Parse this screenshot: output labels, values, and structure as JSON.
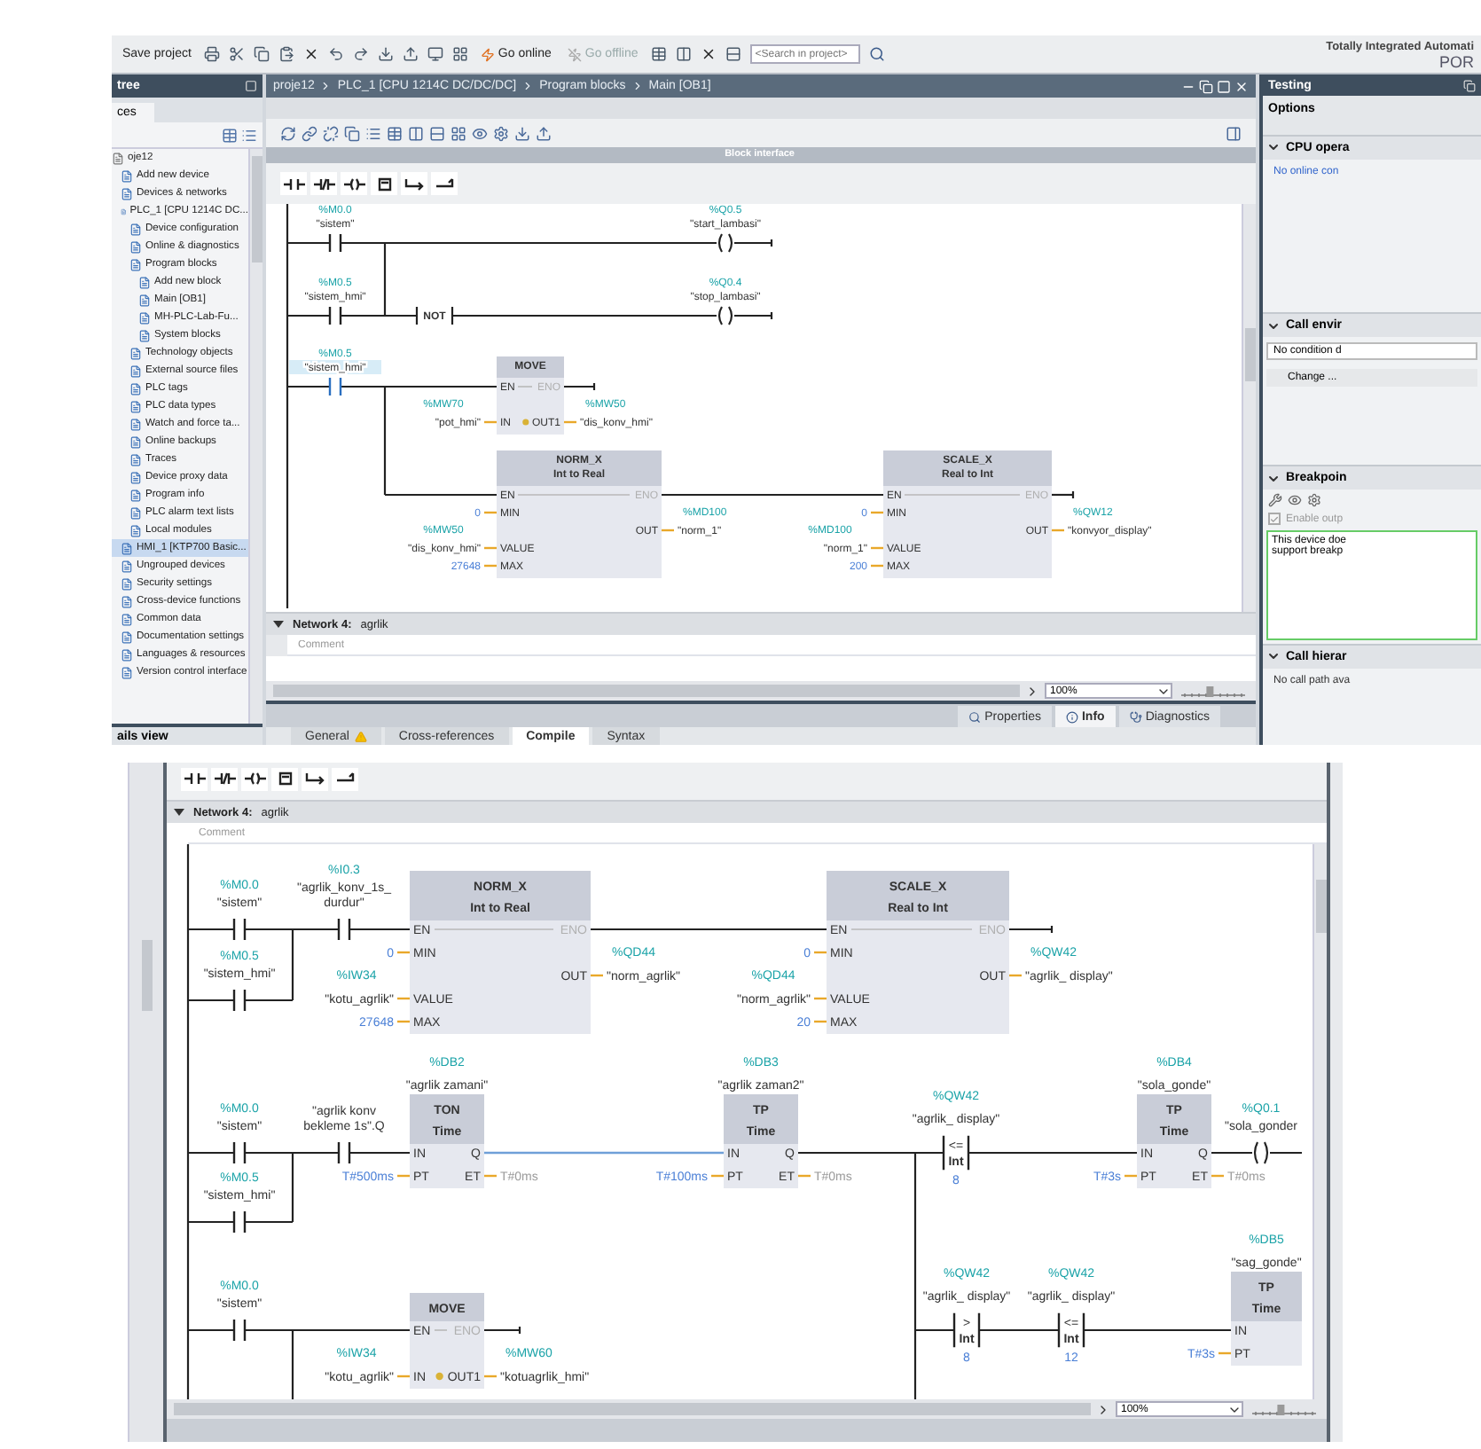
{
  "toolbar": {
    "save_label": "Save project",
    "go_online": "Go online",
    "go_offline": "Go offline",
    "search": {
      "placeholder": "<Search in project>"
    }
  },
  "product": {
    "title": "Totally Integrated Automati",
    "subtitle": "POR"
  },
  "project_tree": {
    "title": "tree",
    "tab": "ces",
    "details_view": "ails view",
    "items": [
      {
        "label": "oje12",
        "selected": false,
        "children": [
          {
            "label": "Add new device",
            "selected": false
          },
          {
            "label": "Devices & networks",
            "selected": false
          },
          {
            "label": "PLC_1 [CPU 1214C DC...",
            "selected": false,
            "children": [
              {
                "label": "Device configuration",
                "selected": false
              },
              {
                "label": "Online & diagnostics",
                "selected": false
              },
              {
                "label": "Program blocks",
                "selected": false,
                "children": [
                  {
                    "label": "Add new block",
                    "selected": false
                  },
                  {
                    "label": "Main [OB1]",
                    "selected": false
                  },
                  {
                    "label": "MH-PLC-Lab-Fu...",
                    "selected": false
                  },
                  {
                    "label": "System blocks",
                    "selected": false
                  }
                ]
              },
              {
                "label": "Technology objects",
                "selected": false
              },
              {
                "label": "External source files",
                "selected": false
              },
              {
                "label": "PLC tags",
                "selected": false
              },
              {
                "label": "PLC data types",
                "selected": false
              },
              {
                "label": "Watch and force ta...",
                "selected": false
              },
              {
                "label": "Online backups",
                "selected": false
              },
              {
                "label": "Traces",
                "selected": false
              },
              {
                "label": "Device proxy data",
                "selected": false
              },
              {
                "label": "Program info",
                "selected": false
              },
              {
                "label": "PLC alarm text lists",
                "selected": false
              },
              {
                "label": "Local modules",
                "selected": false
              }
            ]
          },
          {
            "label": "HMI_1 [KTP700 Basic...",
            "selected": true
          },
          {
            "label": "Ungrouped devices",
            "selected": false
          },
          {
            "label": "Security settings",
            "selected": false
          },
          {
            "label": "Cross-device functions",
            "selected": false
          },
          {
            "label": "Common data",
            "selected": false
          },
          {
            "label": "Documentation settings",
            "selected": false
          },
          {
            "label": "Languages & resources",
            "selected": false
          },
          {
            "label": "Version control interface",
            "selected": false
          }
        ]
      }
    ]
  },
  "editor": {
    "breadcrumb": [
      "proje12",
      "PLC_1 [CPU 1214C DC/DC/DC]",
      "Program blocks",
      "Main [OB1]"
    ],
    "block_interface": "Block interface",
    "ladder": [
      {
        "kind": "contact",
        "address": "%M0.0",
        "tag": "\"sistem\"",
        "selected": false
      },
      {
        "kind": "coil",
        "address": "%Q0.5",
        "tag": "\"start_lambasi\"",
        "selected": false
      },
      {
        "kind": "contact",
        "address": "%M0.5",
        "tag": "\"sistem_hmi\"",
        "selected": false
      },
      {
        "kind": "not",
        "label": "NOT",
        "selected": false
      },
      {
        "kind": "coil",
        "address": "%Q0.4",
        "tag": "\"stop_lambasi\"",
        "selected": false
      },
      {
        "kind": "contact",
        "address": "%M0.5",
        "tag": "\"sistem_hmi\"",
        "selected": true
      },
      {
        "kind": "move",
        "title": "MOVE",
        "selected": false,
        "inputs": [
          {
            "pin": "EN"
          },
          {
            "pin": "IN",
            "address": "%MW70",
            "tag": "\"pot_hmi\""
          }
        ],
        "outputs": [
          {
            "pin": "ENO"
          },
          {
            "pin": "OUT1",
            "address": "%MW50",
            "tag": "\"dis_konv_hmi\""
          }
        ]
      },
      {
        "kind": "convert",
        "title": "NORM_X",
        "subtitle": "Int to Real",
        "selected": false,
        "inputs": [
          {
            "pin": "EN"
          },
          {
            "pin": "MIN",
            "value": "0"
          },
          {
            "pin": "VALUE",
            "address": "%MW50",
            "tag": "\"dis_konv_hmi\""
          },
          {
            "pin": "MAX",
            "value": "27648"
          }
        ],
        "outputs": [
          {
            "pin": "ENO"
          },
          {
            "pin": "OUT",
            "address": "%MD100",
            "tag": "\"norm_1\""
          }
        ]
      },
      {
        "kind": "convert",
        "title": "SCALE_X",
        "subtitle": "Real to Int",
        "selected": false,
        "inputs": [
          {
            "pin": "EN"
          },
          {
            "pin": "MIN",
            "value": "0"
          },
          {
            "pin": "VALUE",
            "address": "%MD100",
            "tag": "\"norm_1\""
          },
          {
            "pin": "MAX",
            "value": "200"
          }
        ],
        "outputs": [
          {
            "pin": "ENO"
          },
          {
            "pin": "OUT",
            "address": "%QW12",
            "tag": "\"konvyor_display\""
          }
        ]
      }
    ],
    "next_network": {
      "title": "Network 4:",
      "name": "agrlik",
      "expanded": true,
      "comment_placeholder": "Comment"
    },
    "zoom": "100%",
    "zoom_slider": {
      "level": 0.45
    }
  },
  "inspector_tabs": [
    {
      "label": "Properties",
      "selected": false
    },
    {
      "label": "Info",
      "selected": true
    },
    {
      "label": "Diagnostics",
      "selected": false
    }
  ],
  "inspector_subtabs": [
    {
      "label": "General",
      "selected": false,
      "warning": true
    },
    {
      "label": "Cross-references",
      "selected": false,
      "warning": false
    },
    {
      "label": "Compile",
      "selected": true,
      "warning": false
    },
    {
      "label": "Syntax",
      "selected": false,
      "warning": false
    }
  ],
  "task_pane": {
    "title": "Testing",
    "options_label": "Options",
    "sections": [
      {
        "kind": "message",
        "title": "CPU opera",
        "expanded": true,
        "message": "No online con"
      },
      {
        "kind": "condition",
        "title": "Call envir",
        "expanded": true,
        "field": "No condition d",
        "button": "Change ..."
      },
      {
        "kind": "breakpoints",
        "title": "Breakpoin",
        "expanded": true,
        "checkbox": {
          "label": "Enable outp",
          "checked": true
        },
        "note_lines": [
          "This device doe",
          "support breakp"
        ]
      },
      {
        "kind": "message",
        "title": "Call hierar",
        "expanded": true,
        "message": "No call path ava"
      }
    ]
  },
  "second_view": {
    "network": {
      "title": "Network 4:",
      "name": "agrlik",
      "expanded": true,
      "comment_placeholder": "Comment"
    },
    "zoom": "100%",
    "zoom_slider": {
      "level": 0.45
    },
    "ladder": [
      {
        "kind": "contact",
        "address": "%M0.0",
        "tag": "\"sistem\"",
        "selected": false
      },
      {
        "kind": "contact",
        "address": "%I0.3",
        "tag": "\"agrlik_konv_1s_ durdur\"",
        "selected": false
      },
      {
        "kind": "convert",
        "title": "NORM_X",
        "subtitle": "Int to Real",
        "selected": false,
        "inputs": [
          {
            "pin": "EN"
          },
          {
            "pin": "MIN",
            "value": "0"
          },
          {
            "pin": "VALUE",
            "address": "%IW34",
            "tag": "\"kotu_agrlik\""
          },
          {
            "pin": "MAX",
            "value": "27648"
          }
        ],
        "outputs": [
          {
            "pin": "ENO"
          },
          {
            "pin": "OUT",
            "address": "%QD44",
            "tag": "\"norm_agrlik\""
          }
        ]
      },
      {
        "kind": "convert",
        "title": "SCALE_X",
        "subtitle": "Real to Int",
        "selected": false,
        "inputs": [
          {
            "pin": "EN"
          },
          {
            "pin": "MIN",
            "value": "0"
          },
          {
            "pin": "VALUE",
            "address": "%QD44",
            "tag": "\"norm_agrlik\""
          },
          {
            "pin": "MAX",
            "value": "20"
          }
        ],
        "outputs": [
          {
            "pin": "ENO"
          },
          {
            "pin": "OUT",
            "address": "%QW42",
            "tag": "\"agrlik_ display\""
          }
        ]
      },
      {
        "kind": "contact",
        "address": "%M0.5",
        "tag": "\"sistem_hmi\"",
        "selected": false
      },
      {
        "kind": "contact",
        "address": "%M0.0",
        "tag": "\"sistem\"",
        "selected": false
      },
      {
        "kind": "contact",
        "tag": "\"agrlik konv bekleme 1s\".Q",
        "selected": false
      },
      {
        "kind": "timer",
        "title": "TON",
        "subtitle": "Time",
        "instance_address": "%DB2",
        "instance_tag": "\"agrlik zamani\"",
        "selected": false,
        "inputs": [
          {
            "pin": "IN"
          },
          {
            "pin": "PT",
            "value": "T#500ms"
          }
        ],
        "outputs": [
          {
            "pin": "Q"
          },
          {
            "pin": "ET",
            "value": "T#0ms"
          }
        ]
      },
      {
        "kind": "timer",
        "title": "TP",
        "subtitle": "Time",
        "instance_address": "%DB3",
        "instance_tag": "\"agrlik zaman2\"",
        "selected": false,
        "inputs": [
          {
            "pin": "IN"
          },
          {
            "pin": "PT",
            "value": "T#100ms"
          }
        ],
        "outputs": [
          {
            "pin": "Q"
          },
          {
            "pin": "ET",
            "value": "T#0ms"
          }
        ]
      },
      {
        "kind": "compare",
        "op": "<=",
        "type": "Int",
        "address": "%QW42",
        "tag": "\"agrlik_ display\"",
        "value": "8",
        "selected": false
      },
      {
        "kind": "timer",
        "title": "TP",
        "subtitle": "Time",
        "instance_address": "%DB4",
        "instance_tag": "\"sola_gonde\"",
        "selected": false,
        "inputs": [
          {
            "pin": "IN"
          },
          {
            "pin": "PT",
            "value": "T#3s"
          }
        ],
        "outputs": [
          {
            "pin": "Q"
          },
          {
            "pin": "ET",
            "value": "T#0ms"
          }
        ]
      },
      {
        "kind": "coil",
        "address": "%Q0.1",
        "tag": "\"sola_gonder",
        "selected": false
      },
      {
        "kind": "contact",
        "address": "%M0.5",
        "tag": "\"sistem_hmi\"",
        "selected": false
      },
      {
        "kind": "contact",
        "address": "%M0.0",
        "tag": "\"sistem\"",
        "selected": false
      },
      {
        "kind": "compare",
        "op": ">",
        "type": "Int",
        "address": "%QW42",
        "tag": "\"agrlik_ display\"",
        "value": "8",
        "selected": false
      },
      {
        "kind": "compare",
        "op": "<=",
        "type": "Int",
        "address": "%QW42",
        "tag": "\"agrlik_ display\"",
        "value": "12",
        "selected": false
      },
      {
        "kind": "timer",
        "title": "TP",
        "subtitle": "Time",
        "instance_address": "%DB5",
        "instance_tag": "\"sag_gonde\"",
        "selected": false,
        "inputs": [
          {
            "pin": "IN"
          },
          {
            "pin": "PT",
            "value": "T#3s"
          }
        ]
      },
      {
        "kind": "move",
        "title": "MOVE",
        "selected": false,
        "inputs": [
          {
            "pin": "EN"
          },
          {
            "pin": "IN",
            "address": "%IW34",
            "tag": "\"kotu_agrlik\""
          }
        ],
        "outputs": [
          {
            "pin": "ENO"
          },
          {
            "pin": "OUT1",
            "address": "%MW60",
            "tag": "\"kotuagrlik_hmi\""
          }
        ]
      }
    ]
  }
}
